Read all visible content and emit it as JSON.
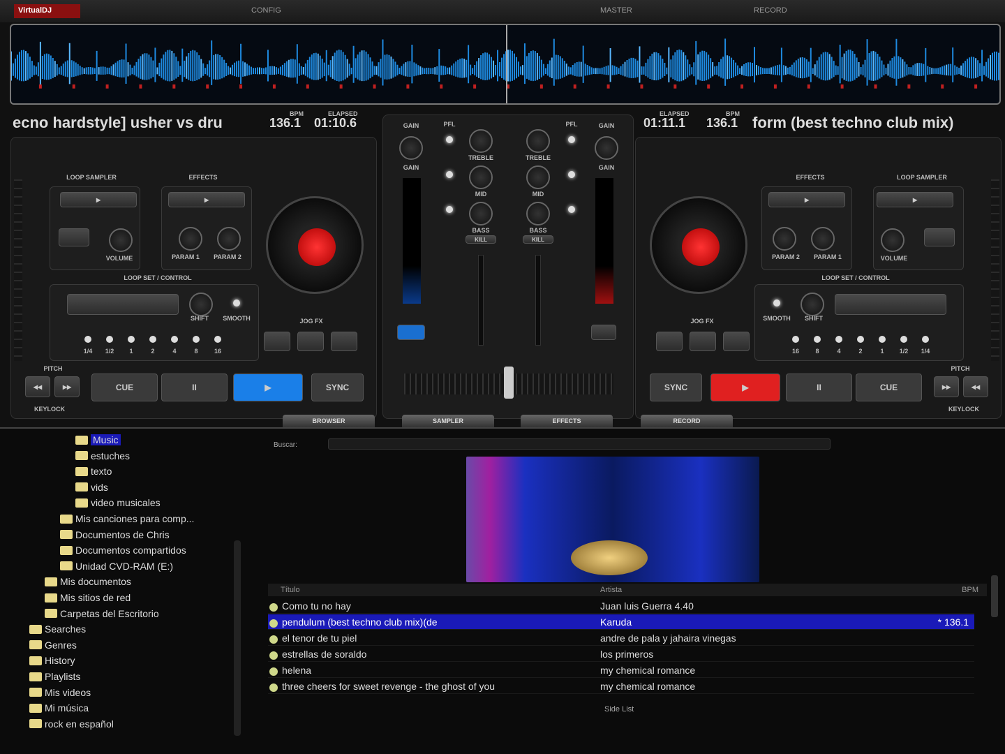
{
  "topbar": {
    "logo": "VirtualDJ",
    "items": [
      "CONFIG",
      "MASTER",
      "RECORD"
    ]
  },
  "deck_left": {
    "title": "ecno hardstyle] usher vs dru",
    "bpm": "136.1",
    "time": "01:10.6",
    "bpm_label": "BPM",
    "time_label": "ELAPSED",
    "loop_sampler": "LOOP SAMPLER",
    "effects": "EFFECTS",
    "volume": "VOLUME",
    "param1": "PARAM 1",
    "param2": "PARAM 2",
    "loop_section": "LOOP SET / CONTROL",
    "shift": "SHIFT",
    "smooth": "SMOOTH",
    "loop_lengths": [
      "1/4",
      "1/2",
      "1",
      "2",
      "4",
      "8",
      "16"
    ],
    "jog": "JOG FX",
    "pitch": "PITCH",
    "cue": "CUE",
    "pause": "II",
    "play": "▶",
    "sync": "SYNC",
    "keylock": "KEYLOCK",
    "color": "#1a8fff",
    "progress": 0.55
  },
  "deck_right": {
    "title": "form (best techno club mix)",
    "bpm": "136.1",
    "time": "01:11.1",
    "bpm_label": "BPM",
    "time_label": "ELAPSED",
    "loop_sampler": "LOOP SAMPLER",
    "effects": "EFFECTS",
    "volume": "VOLUME",
    "param1": "PARAM 1",
    "param2": "PARAM 2",
    "loop_section": "LOOP SET / CONTROL",
    "shift": "SHIFT",
    "smooth": "SMOOTH",
    "loop_lengths": [
      "1/4",
      "1/2",
      "1",
      "2",
      "4",
      "8",
      "16"
    ],
    "jog": "JOG FX",
    "pitch": "PITCH",
    "cue": "CUE",
    "pause": "II",
    "play": "▶",
    "sync": "SYNC",
    "keylock": "KEYLOCK",
    "color": "#e02020",
    "progress": 0.22
  },
  "mixer": {
    "gain": "GAIN",
    "pfl": "PFL",
    "treble": "TREBLE",
    "mid": "MID",
    "bass": "BASS",
    "kill": "KILL",
    "crossfader": 0.5
  },
  "tabs": [
    "BROWSER",
    "SAMPLER",
    "EFFECTS",
    "RECORD"
  ],
  "browser": {
    "search_label": "Buscar:",
    "search_value": "",
    "tree": [
      "Music",
      "estuches",
      "texto",
      "vids",
      "video musicales",
      "Mis canciones para comp...",
      "Documentos de Chris",
      "Documentos compartidos",
      "Unidad CVD-RAM (E:)",
      "Mis documentos",
      "Mis sitios de red",
      "Carpetas del Escritorio",
      "Searches",
      "Genres",
      "History",
      "Playlists",
      "Mis videos",
      "Mi música",
      "rock en español"
    ],
    "columns": [
      "Título",
      "Artista",
      "BPM"
    ],
    "rows": [
      {
        "title": "Como tu no hay",
        "artist": "Juan luis Guerra 4.40",
        "bpm": ""
      },
      {
        "title": "pendulum (best techno club mix)(de",
        "artist": "Karuda",
        "bpm": "* 136.1"
      },
      {
        "title": "el tenor de tu piel",
        "artist": "andre de pala y jahaira vinegas",
        "bpm": ""
      },
      {
        "title": "estrellas de soraldo",
        "artist": "los primeros",
        "bpm": ""
      },
      {
        "title": "helena",
        "artist": "my chemical romance",
        "bpm": ""
      },
      {
        "title": "three cheers for sweet revenge - the ghost of you",
        "artist": "my chemical romance",
        "bpm": ""
      }
    ],
    "footer": "Side List"
  }
}
